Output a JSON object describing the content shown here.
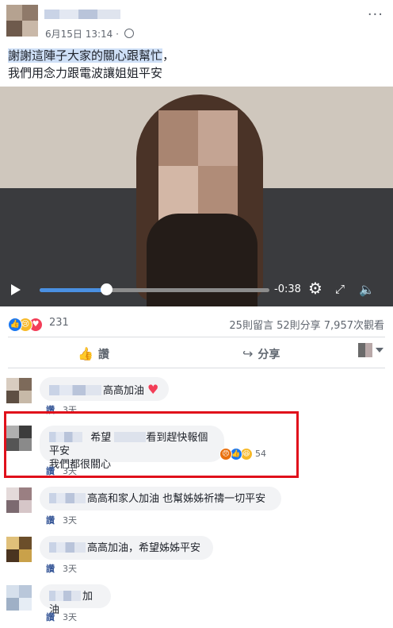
{
  "post": {
    "date": "6月15日 13:14",
    "separator": "·",
    "more": "···",
    "text_hl": "謝謝這陣子大家的關心跟幫忙",
    "text_line1_rest": "，",
    "text_line2": "我們用念力跟電波讓姐姐平安"
  },
  "video": {
    "time": "-0:38",
    "progress": 0.29
  },
  "reactions": {
    "count": "231",
    "comments": "25則留言",
    "shares": "52則分享",
    "views": "7,957次觀看"
  },
  "actions": {
    "like": "讚",
    "share": "分享"
  },
  "comments": [
    {
      "text": "高高加油",
      "like": "讚",
      "time": "3天"
    },
    {
      "text_a": "希望",
      "text_b": "看到趕快報個平安",
      "text_line2": "我們都很關心",
      "reaction_count": "54",
      "like": "讚",
      "time": "3天"
    },
    {
      "text": "高高和家人加油 也幫姊姊祈禱一切平安",
      "like": "讚",
      "time": "3天"
    },
    {
      "text": "高高加油，希望姊姊平安",
      "like": "讚",
      "time": "3天"
    },
    {
      "text": "加油",
      "like": "讚",
      "time": "3天"
    }
  ]
}
